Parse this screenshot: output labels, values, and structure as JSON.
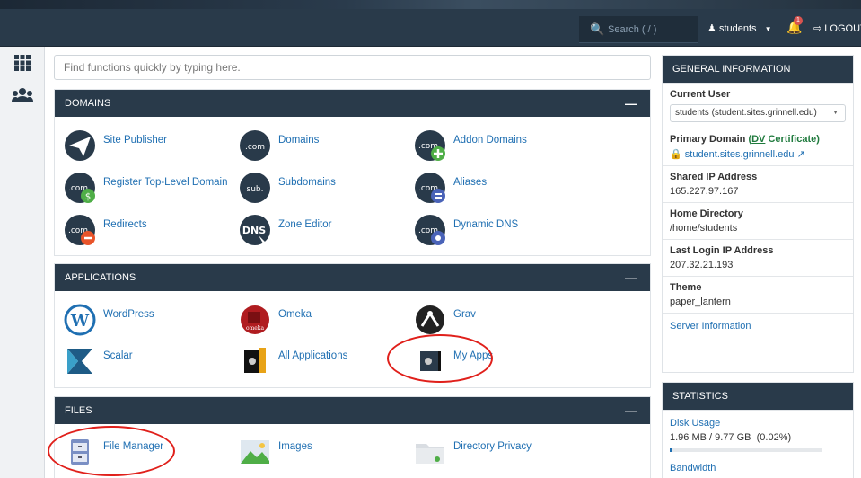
{
  "topbar": {
    "search_placeholder": "Search ( / )",
    "user": "students",
    "notification_count": "1",
    "logout": "LOGOUT"
  },
  "quick_search": {
    "placeholder": "Find functions quickly by typing here."
  },
  "domains": {
    "title": "DOMAINS",
    "items": [
      {
        "label": "Site Publisher"
      },
      {
        "label": "Domains",
        "icon_text": ".com"
      },
      {
        "label": "Addon Domains",
        "icon_text": ".com"
      },
      {
        "label": "Register Top-Level Domain",
        "icon_text": ".com"
      },
      {
        "label": "Subdomains",
        "icon_text": "sub."
      },
      {
        "label": "Aliases",
        "icon_text": ".com"
      },
      {
        "label": "Redirects",
        "icon_text": ".com"
      },
      {
        "label": "Zone Editor",
        "icon_text": "DNS"
      },
      {
        "label": "Dynamic DNS",
        "icon_text": ".com"
      }
    ]
  },
  "applications": {
    "title": "APPLICATIONS",
    "items": [
      {
        "label": "WordPress"
      },
      {
        "label": "Omeka",
        "icon_text": "omeka"
      },
      {
        "label": "Grav"
      },
      {
        "label": "Scalar"
      },
      {
        "label": "All Applications"
      },
      {
        "label": "My Apps"
      }
    ]
  },
  "files": {
    "title": "FILES",
    "items": [
      {
        "label": "File Manager"
      },
      {
        "label": "Images"
      },
      {
        "label": "Directory Privacy"
      }
    ]
  },
  "general": {
    "title": "GENERAL INFORMATION",
    "current_user_label": "Current User",
    "current_user_value": "students (student.sites.grinnell.edu)",
    "primary_domain_label": "Primary Domain",
    "primary_domain_open": "(",
    "dv": "DV",
    "certificate": " Certificate)",
    "primary_domain_value": "student.sites.grinnell.edu",
    "shared_ip_label": "Shared IP Address",
    "shared_ip_value": "165.227.97.167",
    "home_dir_label": "Home Directory",
    "home_dir_value": "/home/students",
    "last_login_label": "Last Login IP Address",
    "last_login_value": "207.32.21.193",
    "theme_label": "Theme",
    "theme_value": "paper_lantern",
    "server_info": "Server Information"
  },
  "statistics": {
    "title": "STATISTICS",
    "disk_usage_label": "Disk Usage",
    "disk_usage_value": "1.96 MB / 9.77 GB",
    "disk_usage_pct": "(0.02%)",
    "disk_usage_fraction": 0.0002,
    "bandwidth_label": "Bandwidth"
  },
  "colors": {
    "header": "#293a4a",
    "link": "#1f6fb2",
    "highlight": "#e0201b"
  }
}
